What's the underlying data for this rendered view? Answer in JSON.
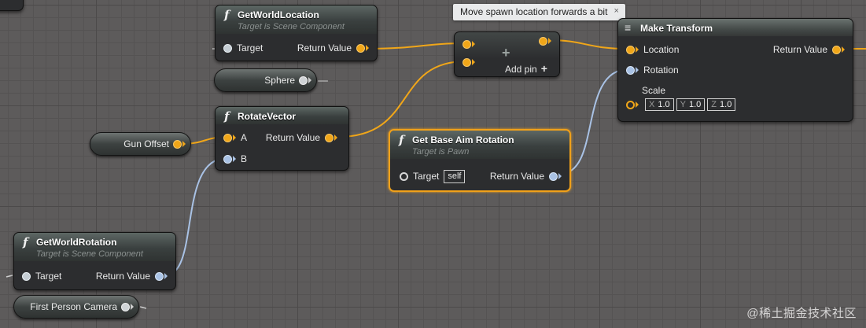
{
  "comment": {
    "text": "Move spawn location forwards a bit",
    "close": "×"
  },
  "nodes": {
    "get_world_location": {
      "title": "GetWorldLocation",
      "subtitle": "Target is Scene Component",
      "pin_target": "Target",
      "pin_return": "Return Value"
    },
    "rotate_vector": {
      "title": "RotateVector",
      "pin_a": "A",
      "pin_b": "B",
      "pin_return": "Return Value"
    },
    "get_world_rotation": {
      "title": "GetWorldRotation",
      "subtitle": "Target is Scene Component",
      "pin_target": "Target",
      "pin_return": "Return Value"
    },
    "get_base_aim_rotation": {
      "title": "Get Base Aim Rotation",
      "subtitle": "Target is Pawn",
      "pin_target": "Target",
      "target_default": "self",
      "pin_return": "Return Value"
    },
    "add": {
      "add_pin_label": "Add pin"
    },
    "make_transform": {
      "title": "Make Transform",
      "pin_location": "Location",
      "pin_rotation": "Rotation",
      "pin_scale": "Scale",
      "pin_return": "Return Value",
      "scale": [
        {
          "axis": "X",
          "value": "1.0"
        },
        {
          "axis": "Y",
          "value": "1.0"
        },
        {
          "axis": "Z",
          "value": "1.0"
        }
      ]
    }
  },
  "variables": {
    "sphere": "Sphere",
    "gun_offset": "Gun Offset",
    "first_person_camera": "First Person Camera"
  },
  "watermark": "@稀土掘金技术社区",
  "colors": {
    "vector_pin": "#f0a619",
    "rotator_pin": "#a9c2e5",
    "selected_outline": "#f1a11a",
    "background": "#5d5b5b"
  }
}
